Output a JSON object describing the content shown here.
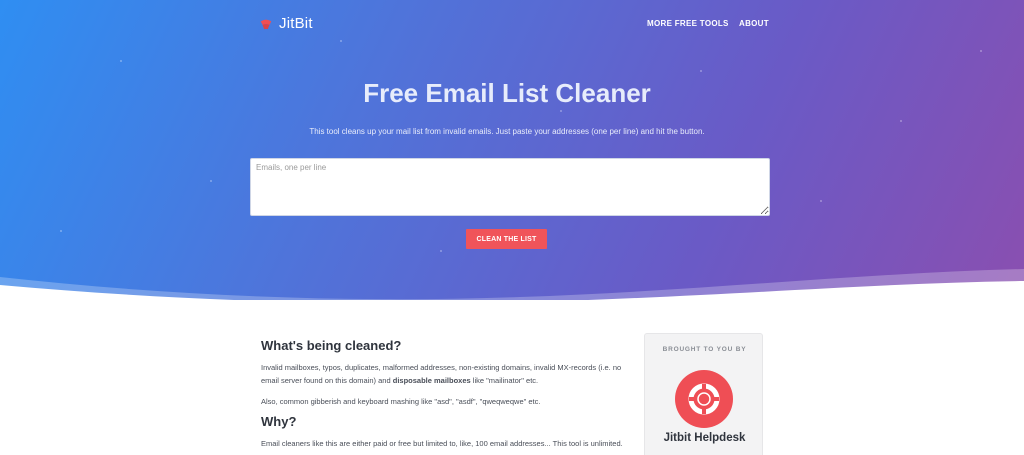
{
  "nav": {
    "logo_text": "JitBit",
    "links": [
      "MORE FREE TOOLS",
      "ABOUT"
    ]
  },
  "hero": {
    "title": "Free Email List Cleaner",
    "description": "This tool cleans up your mail list from invalid emails. Just paste your addresses (one per line) and hit the button.",
    "textarea_placeholder": "Emails, one per line",
    "button_label": "CLEAN THE LIST"
  },
  "content": {
    "section1_heading": "What's being cleaned?",
    "section1_p1_a": "Invalid mailboxes, typos, duplicates, malformed addresses, non-existing domains, invalid MX-records (i.e. no email server found on this domain) and ",
    "section1_p1_bold": "disposable mailboxes",
    "section1_p1_b": " like \"mailinator\" etc.",
    "section1_p2": "Also, common gibberish and keyboard mashing like \"asd\", \"asdf\", \"qweqweqwe\" etc.",
    "section2_heading": "Why?",
    "section2_p1": "Email cleaners like this are either paid or free but limited to, like, 100 email addresses... This tool is unlimited."
  },
  "sidebar": {
    "title": "BROUGHT TO YOU BY",
    "brand": "Jitbit Helpdesk"
  },
  "colors": {
    "gradient_start": "#2f8ef2",
    "gradient_end": "#8a4fb0",
    "button": "#f0545a",
    "logo_red": "#ef4e55"
  },
  "icons": {
    "logo": "jitbit-logo-icon",
    "sidebar": "lifebuoy-icon"
  }
}
